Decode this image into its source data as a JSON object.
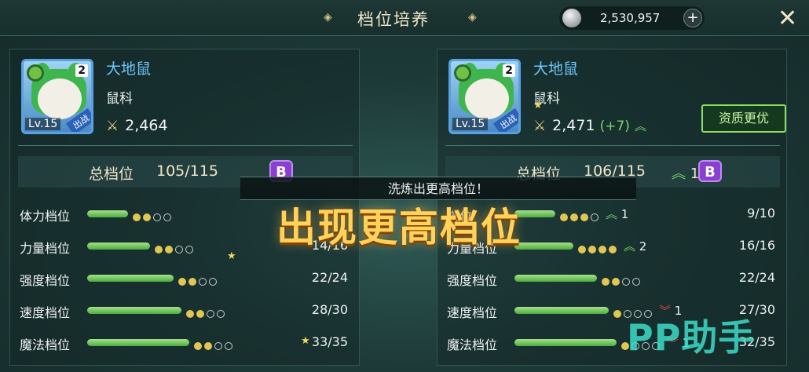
{
  "header": {
    "title": "档位培养",
    "coins": "2,530,957",
    "plus_icon": "+",
    "close_icon": "✕",
    "ornament": "◈"
  },
  "left": {
    "name": "大地鼠",
    "family": "鼠科",
    "stars": "2",
    "level": "Lv.15",
    "tag": "出战",
    "power": "2,464",
    "total_label": "总档位",
    "total_value": "105/115",
    "grade": "B",
    "rows": [
      {
        "label": "体力档位",
        "value": "",
        "level": 0.22,
        "filled": 2,
        "total": 4
      },
      {
        "label": "力量档位",
        "value": "14/16",
        "level": 0.5,
        "filled": 2,
        "total": 4
      },
      {
        "label": "强度档位",
        "value": "22/24",
        "level": 0.8,
        "filled": 2,
        "total": 4
      },
      {
        "label": "速度档位",
        "value": "28/30",
        "level": 0.9,
        "filled": 2,
        "total": 4
      },
      {
        "label": "魔法档位",
        "value": "33/35",
        "level": 1.0,
        "filled": 2,
        "total": 4
      }
    ]
  },
  "right": {
    "name": "大地鼠",
    "family": "鼠科",
    "stars": "2",
    "level": "Lv.15",
    "tag": "出战",
    "power": "2,471",
    "power_delta": "(+7)",
    "better_button": "资质更优",
    "total_label": "总档位",
    "total_value": "106/115",
    "total_delta": "1",
    "grade": "B",
    "rows": [
      {
        "label": "档位",
        "value": "9/10",
        "level": 0.22,
        "filled": 3,
        "total": 4,
        "delta": "1",
        "dir": "up"
      },
      {
        "label": "力量档位",
        "value": "16/16",
        "level": 0.45,
        "filled": 4,
        "total": 4,
        "delta": "2",
        "dir": "up"
      },
      {
        "label": "强度档位",
        "value": "22/24",
        "level": 0.75,
        "filled": 2,
        "total": 4,
        "delta": "",
        "dir": ""
      },
      {
        "label": "速度档位",
        "value": "27/30",
        "level": 0.9,
        "filled": 1,
        "total": 4,
        "delta": "1",
        "dir": "down"
      },
      {
        "label": "魔法档位",
        "value": "32/35",
        "level": 1.0,
        "filled": 1,
        "total": 4,
        "delta": "1",
        "dir": "down"
      }
    ]
  },
  "popup": {
    "toast": "洗炼出更高档位！",
    "banner": "出现更高档位"
  },
  "watermark": "PP助手"
}
